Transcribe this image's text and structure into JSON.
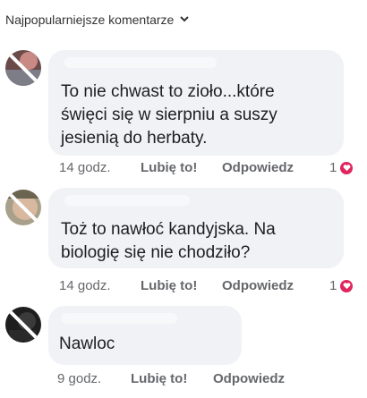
{
  "header": {
    "sort_label": "Najpopularniejsze komentarze"
  },
  "comments": [
    {
      "text_lines": [
        "To nie chwast to zioło...które",
        "święci się w sierpniu a suszy",
        "jesienią do herbaty."
      ],
      "time": "14 godz.",
      "like_label": "Lubię to!",
      "reply_label": "Odpowiedz",
      "reaction_count": "1"
    },
    {
      "text_lines": [
        "Toż to nawłoć kandyjska. Na",
        "biologię się nie chodziło?"
      ],
      "time": "14 godz.",
      "like_label": "Lubię to!",
      "reply_label": "Odpowiedz",
      "reaction_count": "1"
    },
    {
      "text_lines": [
        "Nawloc"
      ],
      "time": "9 godz.",
      "like_label": "Lubię to!",
      "reply_label": "Odpowiedz"
    }
  ],
  "colors": {
    "bubble": "#f0f2f5",
    "meta_text": "#65676b",
    "heart": "#e0245e"
  }
}
